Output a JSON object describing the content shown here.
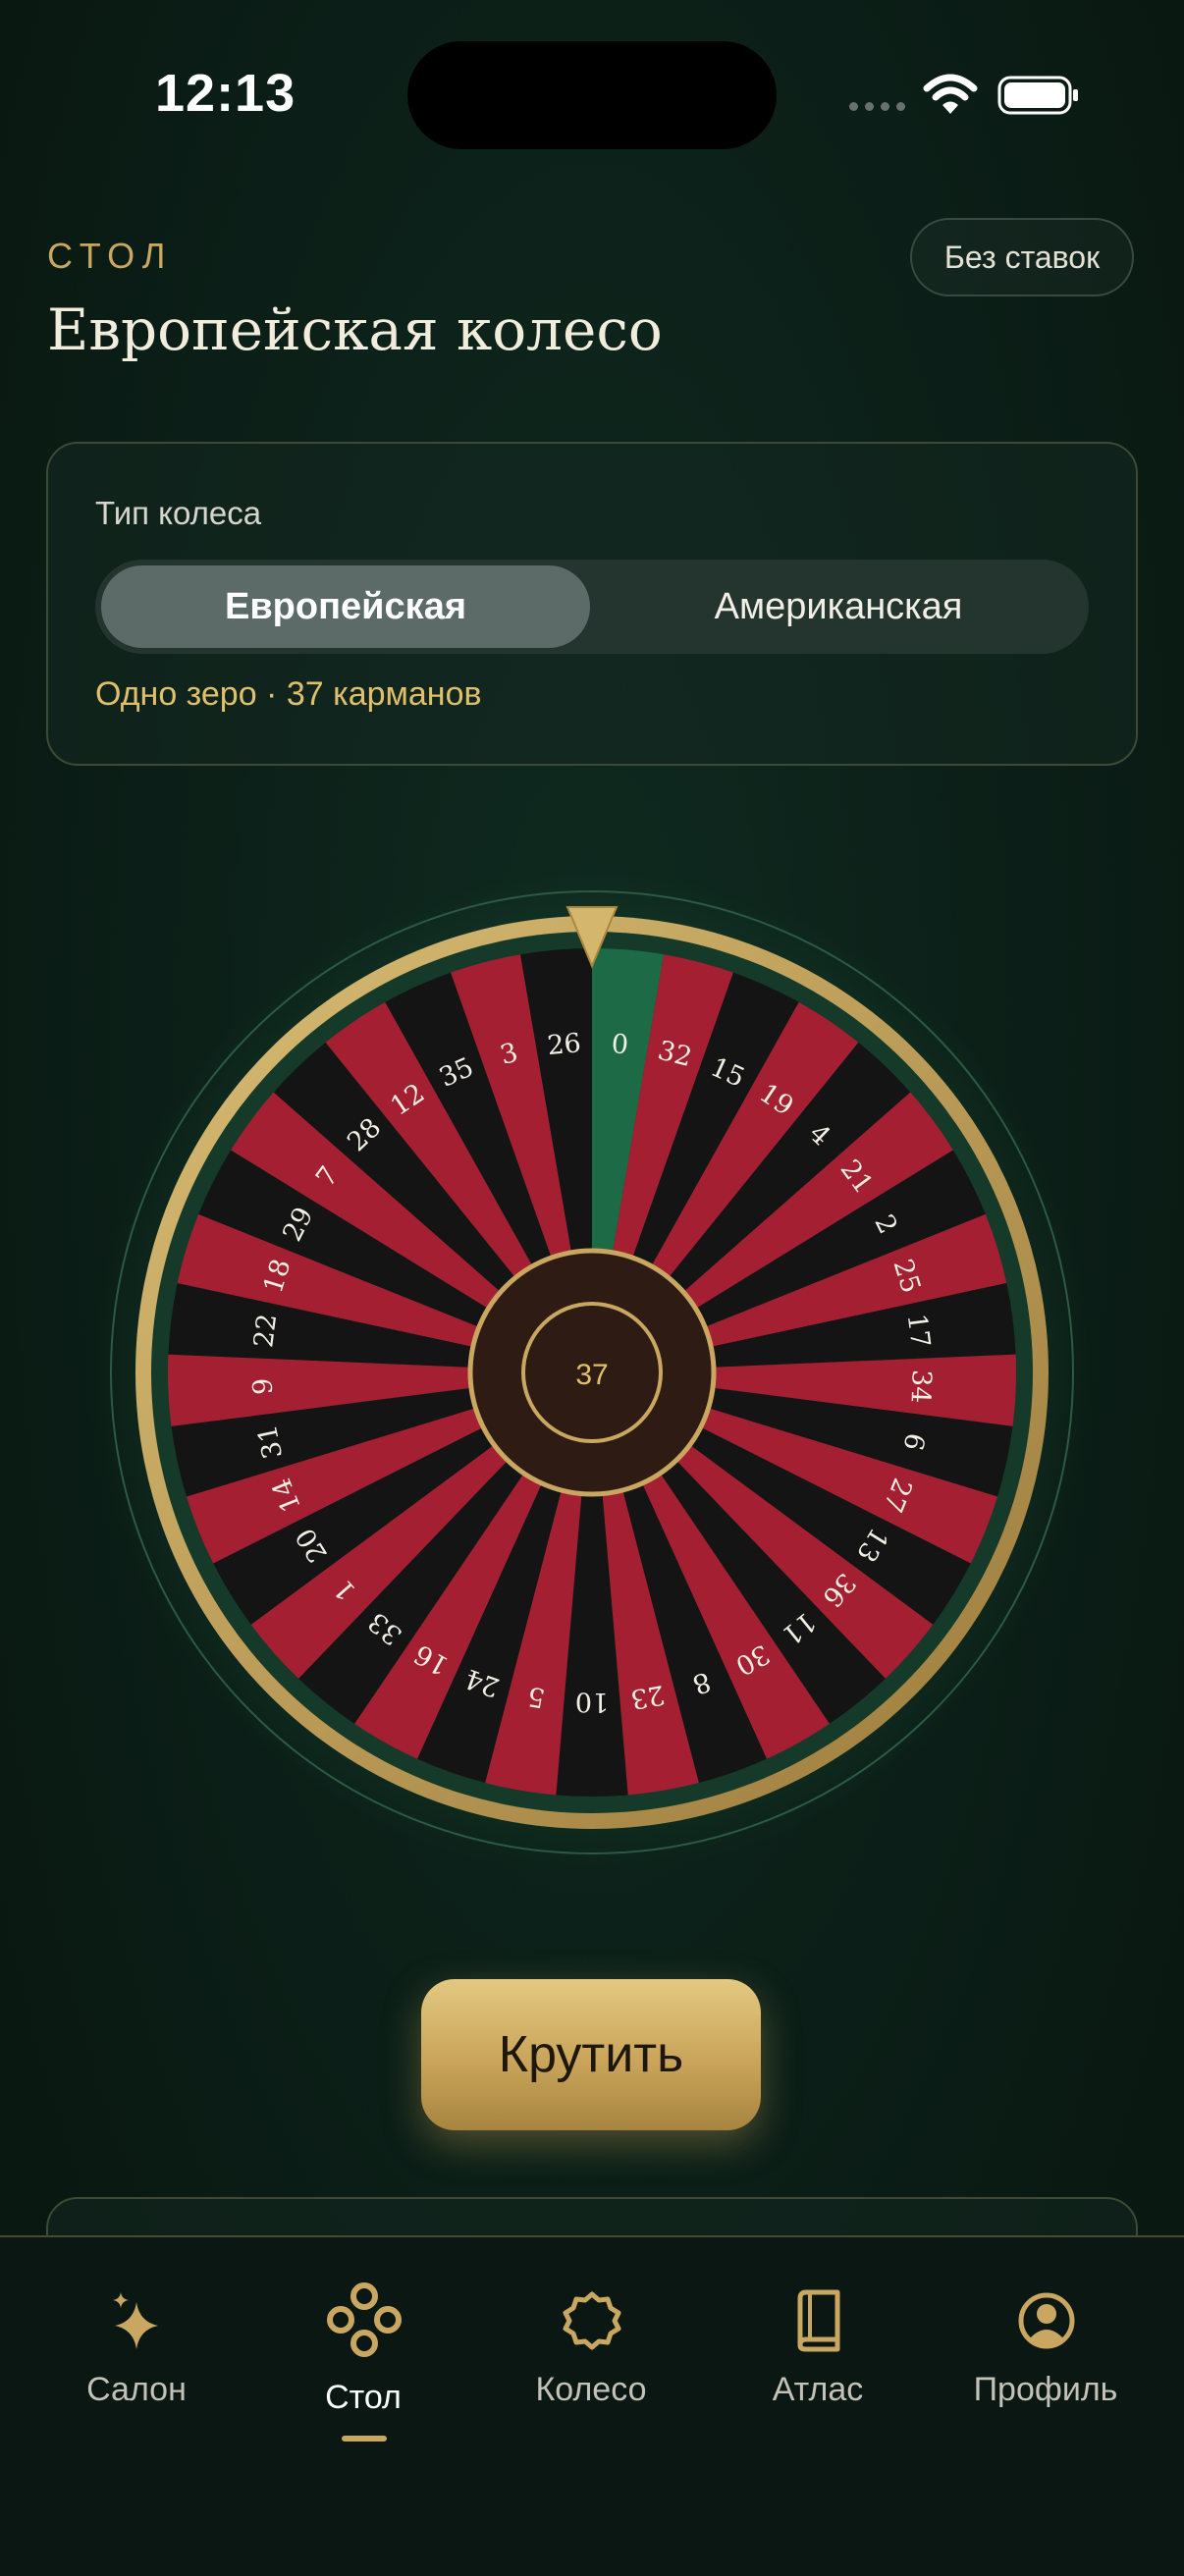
{
  "status_bar": {
    "time": "12:13"
  },
  "header": {
    "eyebrow": "СТОЛ",
    "title": "Европейская колесо",
    "no_bets_label": "Без ставок"
  },
  "wheel_type_card": {
    "label": "Тип колеса",
    "options": [
      "Европейская",
      "Американская"
    ],
    "selected": "Европейская",
    "note": "Одно зеро · 37 карманов"
  },
  "wheel": {
    "numbers": [
      0,
      32,
      15,
      19,
      4,
      21,
      2,
      25,
      17,
      34,
      6,
      27,
      13,
      36,
      11,
      30,
      8,
      23,
      10,
      5,
      24,
      16,
      33,
      1,
      20,
      14,
      31,
      9,
      22,
      18,
      29,
      7,
      28,
      12,
      35,
      3,
      26
    ],
    "red_numbers": [
      1,
      3,
      5,
      7,
      9,
      12,
      14,
      16,
      18,
      19,
      21,
      23,
      25,
      27,
      30,
      32,
      34,
      36
    ],
    "center_label": "37",
    "colors": {
      "red": "#a31f31",
      "black": "#141414",
      "green": "#1c6b46",
      "gold": "#c9a760",
      "hub": "#2e1c14"
    }
  },
  "spin_button": {
    "label": "Крутить"
  },
  "tab_bar": {
    "tabs": [
      {
        "label": "Салон",
        "icon": "sparkle-icon"
      },
      {
        "label": "Стол",
        "icon": "chips-icon",
        "active": true
      },
      {
        "label": "Колесо",
        "icon": "wheel-icon"
      },
      {
        "label": "Атлас",
        "icon": "book-icon"
      },
      {
        "label": "Профиль",
        "icon": "profile-icon"
      }
    ]
  }
}
